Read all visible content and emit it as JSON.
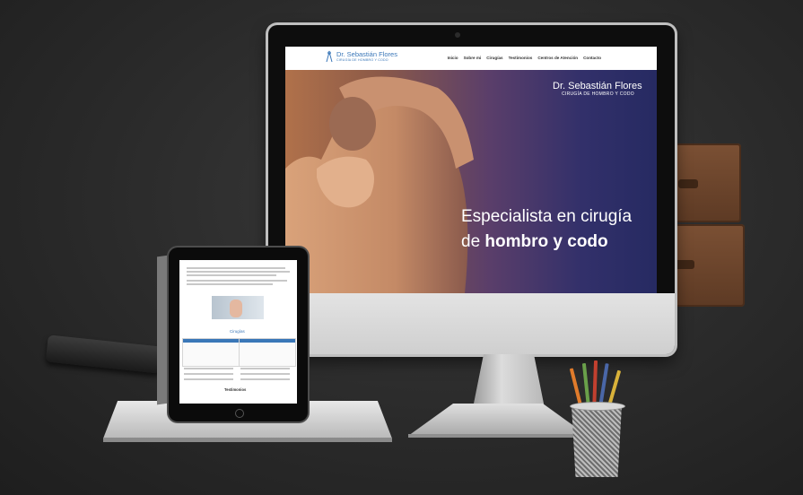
{
  "website": {
    "logo_name": "Dr. Sebastián Flores",
    "logo_subtitle": "CIRUGÍA DE HOMBRO Y CODO",
    "nav": [
      "Inicio",
      "Sobre mi",
      "Cirugías",
      "Testimonios",
      "Centros de Atención",
      "Contacto"
    ],
    "hero_line1": "Especialista en cirugía",
    "hero_line2_prefix": "de ",
    "hero_line2_bold": "hombro y codo"
  },
  "tablet": {
    "section_title": "Cirugías",
    "testimonials_title": "Testimonios"
  },
  "colors": {
    "brand_blue": "#3a77b8",
    "hero_start": "#b0714a",
    "hero_end": "#262a62"
  }
}
